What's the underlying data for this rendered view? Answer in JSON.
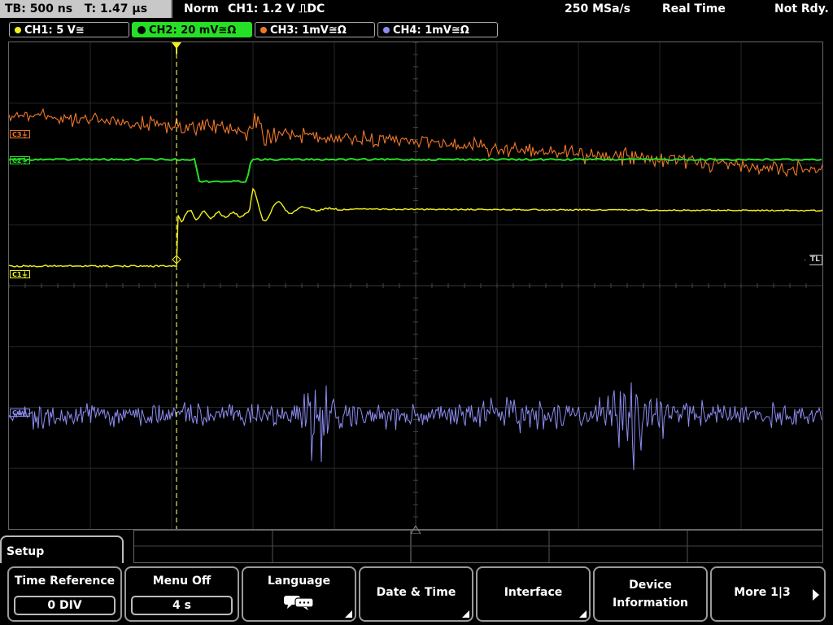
{
  "status": {
    "timebase": "TB: 500 ns",
    "trigger_time": "T: 1.47 µs",
    "mode": "Norm",
    "trigger_info": "CH1: 1.2 V ⎍DC",
    "sample_rate": "250 MSa/s",
    "acq_mode": "Real Time",
    "state": "Not Rdy."
  },
  "channels": [
    {
      "label": "CH1: 5 V≅",
      "color": "#f2f21a",
      "active": false
    },
    {
      "label": "CH2: 20 mV≅Ω",
      "color": "#26e026",
      "active": true
    },
    {
      "label": "CH3: 1mV≅Ω",
      "color": "#f07828",
      "active": false
    },
    {
      "label": "CH4: 1mV≅Ω",
      "color": "#8c8cf0",
      "active": false
    }
  ],
  "markers": {
    "c1": "C1⏚",
    "c2": "C2⏚",
    "c3": "C3⏚",
    "c4": "C4⏚",
    "trigger_level": "TL",
    "trigger_position": "T"
  },
  "menu": {
    "title": "Setup",
    "softkeys": [
      {
        "label": "Time Reference",
        "value": "0 DIV"
      },
      {
        "label": "Menu Off",
        "value": "4 s"
      },
      {
        "label": "Language",
        "icon": "speech-bubbles-icon"
      },
      {
        "label": "Date & Time"
      },
      {
        "label": "Interface"
      },
      {
        "label": "Device",
        "label2": "Information"
      },
      {
        "label": "More 1|3"
      }
    ]
  }
}
